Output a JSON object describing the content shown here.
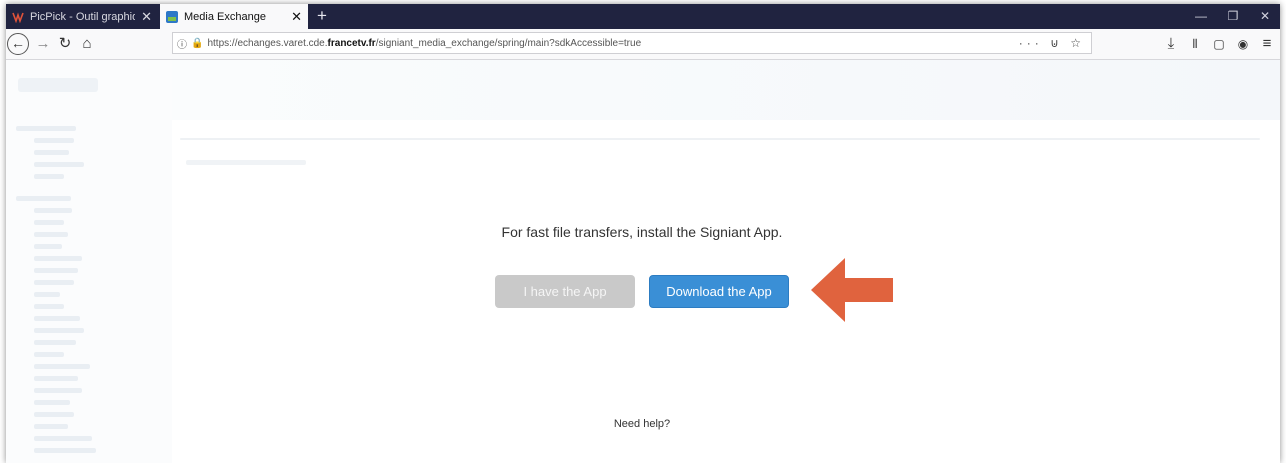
{
  "browser": {
    "tabs": [
      {
        "label": "PicPick - Outil graphique tout",
        "favicon_color": "#e0533a"
      },
      {
        "label": "Media Exchange",
        "favicon_color": "#2e78c7"
      }
    ],
    "url_host_prefix": "https://echanges.varet.cde.",
    "url_host_bold": "francetv.fr",
    "url_path": "/signiant_media_exchange/spring/main?sdkAccessible=true",
    "url_actions": "··· ⊍ ☆"
  },
  "main": {
    "message": "For fast file transfers, install the Signiant App.",
    "have_app_label": "I have the App",
    "download_label": "Download the App",
    "help_text": "Need help?"
  },
  "colors": {
    "titlebar": "#202340",
    "primary_button": "#3a8fd6",
    "secondary_button": "#c9c9c9",
    "arrow": "#e0633e"
  }
}
